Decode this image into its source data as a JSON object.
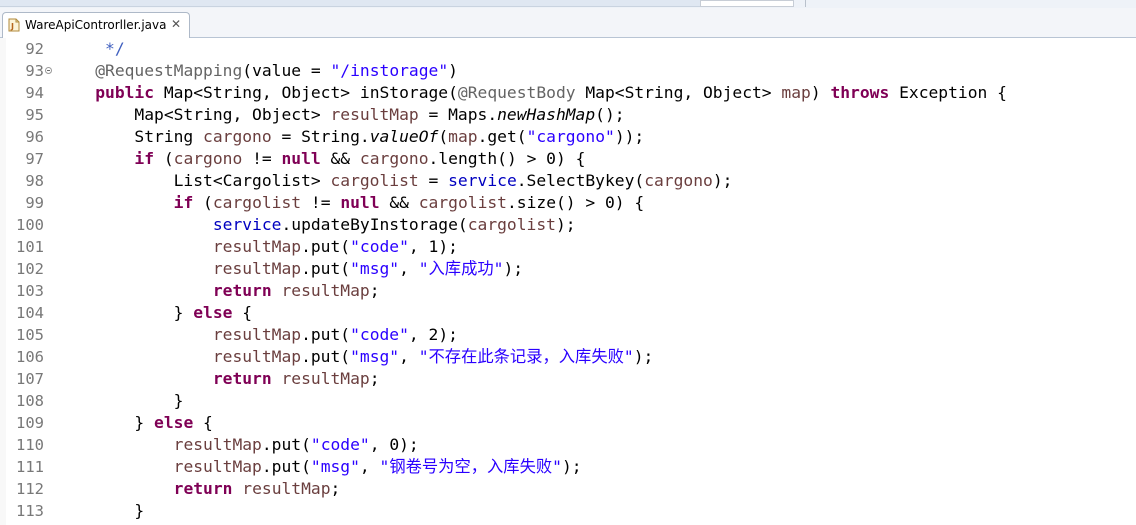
{
  "tab": {
    "label": "WareApiControrller.java",
    "close": "✕",
    "icon": "java-file-icon"
  },
  "colors": {
    "keyword": "#7f0055",
    "string": "#2a00ff",
    "annotation": "#646464",
    "comment": "#3f5fbf",
    "field": "#0000c0",
    "local_var": "#6a3e3e",
    "line_number": "#787878"
  },
  "lines": [
    {
      "num": "92",
      "tokens": [
        [
          "c",
          "     */"
        ]
      ]
    },
    {
      "num": "93",
      "fold": true,
      "tokens": [
        [
          "p",
          "    "
        ],
        [
          "a",
          "@RequestMapping"
        ],
        [
          "p",
          "(value = "
        ],
        [
          "s",
          "\"/instorage\""
        ],
        [
          "p",
          ")"
        ]
      ]
    },
    {
      "num": "94",
      "tokens": [
        [
          "p",
          "    "
        ],
        [
          "k",
          "public"
        ],
        [
          "p",
          " Map<String, Object> inStorage("
        ],
        [
          "a",
          "@RequestBody"
        ],
        [
          "p",
          " Map<String, Object> "
        ],
        [
          "v",
          "map"
        ],
        [
          "p",
          ") "
        ],
        [
          "k",
          "throws"
        ],
        [
          "p",
          " Exception {"
        ]
      ]
    },
    {
      "num": "95",
      "tokens": [
        [
          "p",
          "        Map<String, Object> "
        ],
        [
          "v",
          "resultMap"
        ],
        [
          "p",
          " = Maps."
        ],
        [
          "i",
          "newHashMap"
        ],
        [
          "p",
          "();"
        ]
      ]
    },
    {
      "num": "96",
      "tokens": [
        [
          "p",
          "        String "
        ],
        [
          "v",
          "cargono"
        ],
        [
          "p",
          " = String."
        ],
        [
          "i",
          "valueOf"
        ],
        [
          "p",
          "("
        ],
        [
          "v",
          "map"
        ],
        [
          "p",
          ".get("
        ],
        [
          "s",
          "\"cargono\""
        ],
        [
          "p",
          "));"
        ]
      ]
    },
    {
      "num": "97",
      "tokens": [
        [
          "p",
          "        "
        ],
        [
          "k",
          "if"
        ],
        [
          "p",
          " ("
        ],
        [
          "v",
          "cargono"
        ],
        [
          "p",
          " != "
        ],
        [
          "k",
          "null"
        ],
        [
          "p",
          " && "
        ],
        [
          "v",
          "cargono"
        ],
        [
          "p",
          ".length() > 0) {"
        ]
      ]
    },
    {
      "num": "98",
      "tokens": [
        [
          "p",
          "            List<Cargolist> "
        ],
        [
          "v",
          "cargolist"
        ],
        [
          "p",
          " = "
        ],
        [
          "f",
          "service"
        ],
        [
          "p",
          ".SelectBykey("
        ],
        [
          "v",
          "cargono"
        ],
        [
          "p",
          ");"
        ]
      ]
    },
    {
      "num": "99",
      "tokens": [
        [
          "p",
          "            "
        ],
        [
          "k",
          "if"
        ],
        [
          "p",
          " ("
        ],
        [
          "v",
          "cargolist"
        ],
        [
          "p",
          " != "
        ],
        [
          "k",
          "null"
        ],
        [
          "p",
          " && "
        ],
        [
          "v",
          "cargolist"
        ],
        [
          "p",
          ".size() > 0) {"
        ]
      ]
    },
    {
      "num": "100",
      "tokens": [
        [
          "p",
          "                "
        ],
        [
          "f",
          "service"
        ],
        [
          "p",
          ".updateByInstorage("
        ],
        [
          "v",
          "cargolist"
        ],
        [
          "p",
          ");"
        ]
      ]
    },
    {
      "num": "101",
      "tokens": [
        [
          "p",
          "                "
        ],
        [
          "v",
          "resultMap"
        ],
        [
          "p",
          ".put("
        ],
        [
          "s",
          "\"code\""
        ],
        [
          "p",
          ", 1);"
        ]
      ]
    },
    {
      "num": "102",
      "tokens": [
        [
          "p",
          "                "
        ],
        [
          "v",
          "resultMap"
        ],
        [
          "p",
          ".put("
        ],
        [
          "s",
          "\"msg\""
        ],
        [
          "p",
          ", "
        ],
        [
          "s",
          "\"入库成功\""
        ],
        [
          "p",
          ");"
        ]
      ]
    },
    {
      "num": "103",
      "tokens": [
        [
          "p",
          "                "
        ],
        [
          "k",
          "return"
        ],
        [
          "p",
          " "
        ],
        [
          "v",
          "resultMap"
        ],
        [
          "p",
          ";"
        ]
      ]
    },
    {
      "num": "104",
      "tokens": [
        [
          "p",
          "            } "
        ],
        [
          "k",
          "else"
        ],
        [
          "p",
          " {"
        ]
      ]
    },
    {
      "num": "105",
      "tokens": [
        [
          "p",
          "                "
        ],
        [
          "v",
          "resultMap"
        ],
        [
          "p",
          ".put("
        ],
        [
          "s",
          "\"code\""
        ],
        [
          "p",
          ", 2);"
        ]
      ]
    },
    {
      "num": "106",
      "tokens": [
        [
          "p",
          "                "
        ],
        [
          "v",
          "resultMap"
        ],
        [
          "p",
          ".put("
        ],
        [
          "s",
          "\"msg\""
        ],
        [
          "p",
          ", "
        ],
        [
          "s",
          "\"不存在此条记录，入库失败\""
        ],
        [
          "p",
          ");"
        ]
      ]
    },
    {
      "num": "107",
      "tokens": [
        [
          "p",
          "                "
        ],
        [
          "k",
          "return"
        ],
        [
          "p",
          " "
        ],
        [
          "v",
          "resultMap"
        ],
        [
          "p",
          ";"
        ]
      ]
    },
    {
      "num": "108",
      "tokens": [
        [
          "p",
          "            }"
        ]
      ]
    },
    {
      "num": "109",
      "tokens": [
        [
          "p",
          "        } "
        ],
        [
          "k",
          "else"
        ],
        [
          "p",
          " {"
        ]
      ]
    },
    {
      "num": "110",
      "tokens": [
        [
          "p",
          "            "
        ],
        [
          "v",
          "resultMap"
        ],
        [
          "p",
          ".put("
        ],
        [
          "s",
          "\"code\""
        ],
        [
          "p",
          ", 0);"
        ]
      ]
    },
    {
      "num": "111",
      "tokens": [
        [
          "p",
          "            "
        ],
        [
          "v",
          "resultMap"
        ],
        [
          "p",
          ".put("
        ],
        [
          "s",
          "\"msg\""
        ],
        [
          "p",
          ", "
        ],
        [
          "s",
          "\"钢卷号为空，入库失败\""
        ],
        [
          "p",
          ");"
        ]
      ]
    },
    {
      "num": "112",
      "tokens": [
        [
          "p",
          "            "
        ],
        [
          "k",
          "return"
        ],
        [
          "p",
          " "
        ],
        [
          "v",
          "resultMap"
        ],
        [
          "p",
          ";"
        ]
      ]
    },
    {
      "num": "113",
      "tokens": [
        [
          "p",
          "        }"
        ]
      ]
    }
  ]
}
